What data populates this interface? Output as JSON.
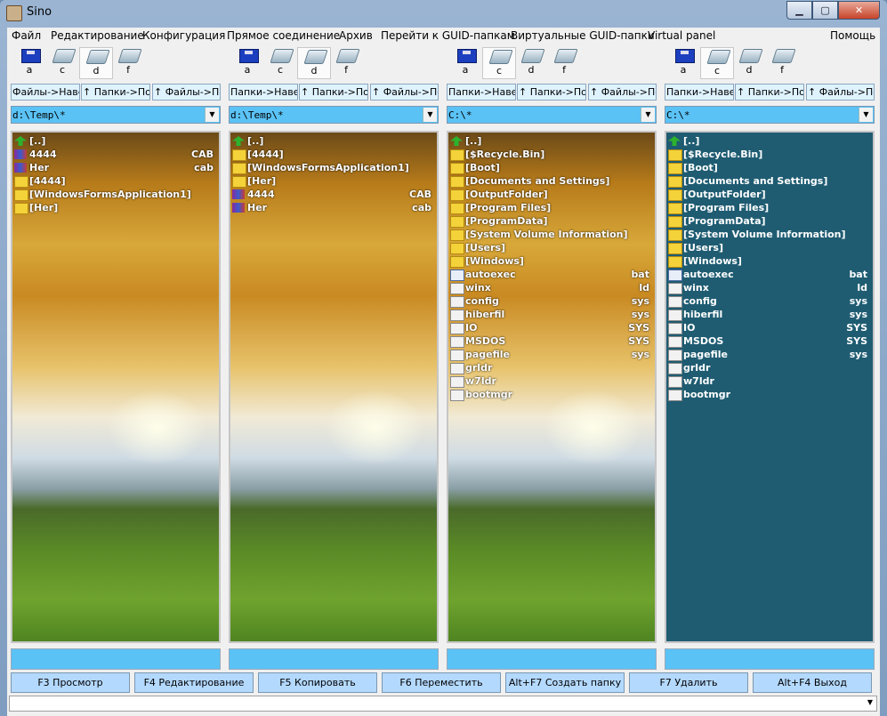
{
  "window": {
    "title": "Sino"
  },
  "menu": [
    "Файл",
    "Редактирование",
    "Конфигурация",
    "Прямое соединение",
    "Архив",
    "Перейти к GUID-папкам",
    "Виртуальные GUID-папки",
    "Virtual panel",
    "Помощь"
  ],
  "drive_labels": [
    "a",
    "c",
    "d",
    "f"
  ],
  "nav_buttons": [
    "Папки->Навер:",
    "↑ Папки->По ;",
    "↑ Файлы->По"
  ],
  "panels": [
    {
      "nav_buttons": [
        "Файлы->Навер:",
        "↑ Папки->По ;",
        "↑ Файлы->По"
      ],
      "active_drive": "d",
      "path": "d:\\Temp\\*",
      "rows": [
        {
          "icon": "up-arrow",
          "name": "[..]",
          "ext": ""
        },
        {
          "icon": "cab-file",
          "name": "4444",
          "ext": "CAB"
        },
        {
          "icon": "cab-file",
          "name": "Her",
          "ext": "cab"
        },
        {
          "icon": "folder",
          "name": "[4444]",
          "ext": ""
        },
        {
          "icon": "folder",
          "name": "[WindowsFormsApplication1]",
          "ext": ""
        },
        {
          "icon": "folder",
          "name": "[Her]",
          "ext": ""
        }
      ]
    },
    {
      "nav_buttons": [
        "Папки->Навер:",
        "↑ Папки->По ;",
        "↑ Файлы->По"
      ],
      "active_drive": "d",
      "path": "d:\\Temp\\*",
      "rows": [
        {
          "icon": "up-arrow",
          "name": "[..]",
          "ext": ""
        },
        {
          "icon": "folder",
          "name": "[4444]",
          "ext": ""
        },
        {
          "icon": "folder",
          "name": "[WindowsFormsApplication1]",
          "ext": ""
        },
        {
          "icon": "folder",
          "name": "[Her]",
          "ext": ""
        },
        {
          "icon": "cab-file",
          "name": "4444",
          "ext": "CAB"
        },
        {
          "icon": "cab-file",
          "name": "Her",
          "ext": "cab"
        }
      ]
    },
    {
      "nav_buttons": [
        "Папки->Навер:",
        "↑ Папки->По ;",
        "↑ Файлы->По"
      ],
      "active_drive": "c",
      "path": "C:\\*",
      "rows": [
        {
          "icon": "up-arrow",
          "name": "[..]",
          "ext": ""
        },
        {
          "icon": "folder",
          "name": "[$Recycle.Bin]",
          "ext": ""
        },
        {
          "icon": "folder",
          "name": "[Boot]",
          "ext": ""
        },
        {
          "icon": "folder",
          "name": "[Documents and Settings]",
          "ext": ""
        },
        {
          "icon": "folder",
          "name": "[OutputFolder]",
          "ext": ""
        },
        {
          "icon": "folder",
          "name": "[Program Files]",
          "ext": ""
        },
        {
          "icon": "folder",
          "name": "[ProgramData]",
          "ext": ""
        },
        {
          "icon": "folder",
          "name": "[System Volume Information]",
          "ext": ""
        },
        {
          "icon": "folder",
          "name": "[Users]",
          "ext": ""
        },
        {
          "icon": "folder",
          "name": "[Windows]",
          "ext": ""
        },
        {
          "icon": "file",
          "name": "autoexec",
          "ext": "bat"
        },
        {
          "icon": "sys-file",
          "name": "winx",
          "ext": "ld"
        },
        {
          "icon": "sys-file",
          "name": "config",
          "ext": "sys"
        },
        {
          "icon": "sys-file",
          "name": "hiberfil",
          "ext": "sys"
        },
        {
          "icon": "sys-file",
          "name": "IO",
          "ext": "SYS"
        },
        {
          "icon": "sys-file",
          "name": "MSDOS",
          "ext": "SYS"
        },
        {
          "icon": "sys-file",
          "name": "pagefile",
          "ext": "sys"
        },
        {
          "icon": "sys-file",
          "name": "grldr",
          "ext": ""
        },
        {
          "icon": "sys-file",
          "name": "w7ldr",
          "ext": ""
        },
        {
          "icon": "sys-file",
          "name": "bootmgr",
          "ext": ""
        }
      ]
    },
    {
      "nav_buttons": [
        "Папки->Навер:",
        "↑ Папки->По ;",
        "↑ Файлы->По"
      ],
      "active_drive": "c",
      "path": "C:\\*",
      "rows": [
        {
          "icon": "up-arrow",
          "name": "[..]",
          "ext": ""
        },
        {
          "icon": "folder",
          "name": "[$Recycle.Bin]",
          "ext": ""
        },
        {
          "icon": "folder",
          "name": "[Boot]",
          "ext": ""
        },
        {
          "icon": "folder",
          "name": "[Documents and Settings]",
          "ext": ""
        },
        {
          "icon": "folder",
          "name": "[OutputFolder]",
          "ext": ""
        },
        {
          "icon": "folder",
          "name": "[Program Files]",
          "ext": ""
        },
        {
          "icon": "folder",
          "name": "[ProgramData]",
          "ext": ""
        },
        {
          "icon": "folder",
          "name": "[System Volume Information]",
          "ext": ""
        },
        {
          "icon": "folder",
          "name": "[Users]",
          "ext": ""
        },
        {
          "icon": "folder",
          "name": "[Windows]",
          "ext": ""
        },
        {
          "icon": "file",
          "name": "autoexec",
          "ext": "bat"
        },
        {
          "icon": "sys-file",
          "name": "winx",
          "ext": "ld"
        },
        {
          "icon": "sys-file",
          "name": "config",
          "ext": "sys"
        },
        {
          "icon": "sys-file",
          "name": "hiberfil",
          "ext": "sys"
        },
        {
          "icon": "sys-file",
          "name": "IO",
          "ext": "SYS"
        },
        {
          "icon": "sys-file",
          "name": "MSDOS",
          "ext": "SYS"
        },
        {
          "icon": "sys-file",
          "name": "pagefile",
          "ext": "sys"
        },
        {
          "icon": "sys-file",
          "name": "grldr",
          "ext": ""
        },
        {
          "icon": "sys-file",
          "name": "w7ldr",
          "ext": ""
        },
        {
          "icon": "sys-file",
          "name": "bootmgr",
          "ext": ""
        }
      ]
    }
  ],
  "function_keys": [
    "F3 Просмотр",
    "F4 Редактирование",
    "F5 Копировать",
    "F6 Переместить",
    "Alt+F7 Создать папку",
    "F7 Удалить",
    "Alt+F4 Выход"
  ],
  "colors": {
    "accent": "#5bc2f5",
    "teal_panel": "#1f5c72",
    "fkey": "#b4d9ff"
  }
}
